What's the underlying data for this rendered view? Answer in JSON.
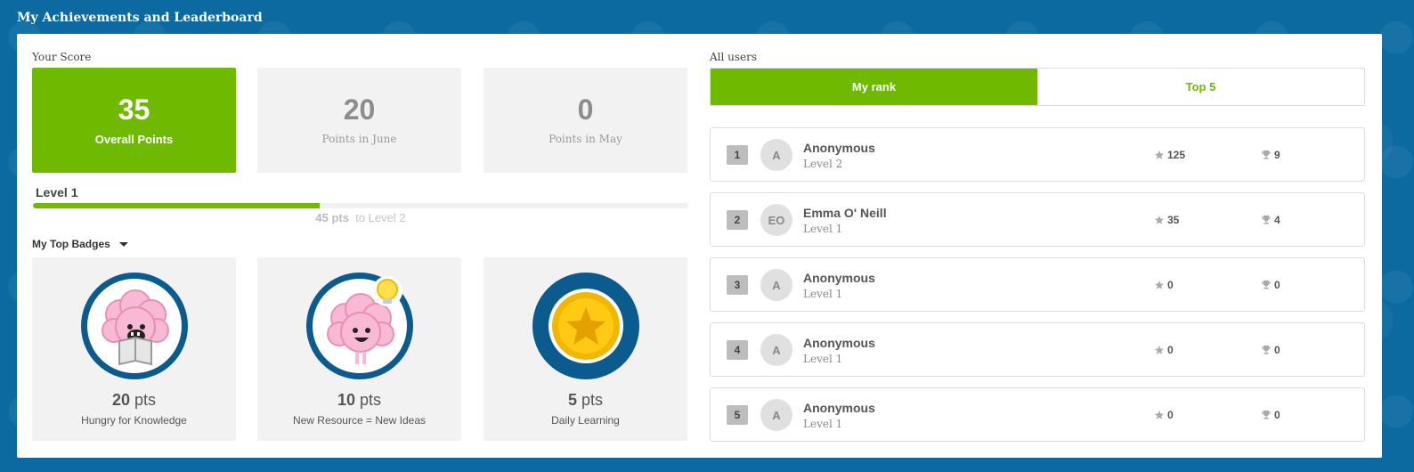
{
  "page": {
    "title": "My Achievements and Leaderboard"
  },
  "score": {
    "label": "Your Score",
    "boxes": [
      {
        "value": "35",
        "caption": "Overall Points"
      },
      {
        "value": "20",
        "caption": "Points in June"
      },
      {
        "value": "0",
        "caption": "Points in May"
      }
    ]
  },
  "level": {
    "title": "Level 1",
    "progress_fraction": 0.437,
    "pts_remaining": "45 pts",
    "to_label": "to Level 2"
  },
  "badges": {
    "dropdown_label": "My Top Badges",
    "items": [
      {
        "pts": "20",
        "unit": "pts",
        "name": "Hungry for Knowledge",
        "icon": "brain-reading-icon"
      },
      {
        "pts": "10",
        "unit": "pts",
        "name": "New Resource = New Ideas",
        "icon": "brain-lightbulb-icon"
      },
      {
        "pts": "5",
        "unit": "pts",
        "name": "Daily Learning",
        "icon": "gold-star-coin-icon"
      }
    ]
  },
  "leaderboard": {
    "label": "All users",
    "tabs": [
      {
        "label": "My rank",
        "active": true
      },
      {
        "label": "Top 5",
        "active": false
      }
    ],
    "rows": [
      {
        "rank": "1",
        "initials": "A",
        "name": "Anonymous",
        "level": "Level 2",
        "stars": "125",
        "trophies": "9"
      },
      {
        "rank": "2",
        "initials": "EO",
        "name": "Emma O' Neill",
        "level": "Level 1",
        "stars": "35",
        "trophies": "4"
      },
      {
        "rank": "3",
        "initials": "A",
        "name": "Anonymous",
        "level": "Level 1",
        "stars": "0",
        "trophies": "0"
      },
      {
        "rank": "4",
        "initials": "A",
        "name": "Anonymous",
        "level": "Level 1",
        "stars": "0",
        "trophies": "0"
      },
      {
        "rank": "5",
        "initials": "A",
        "name": "Anonymous",
        "level": "Level 1",
        "stars": "0",
        "trophies": "0"
      }
    ]
  },
  "colors": {
    "accent": "#6fba00",
    "background": "#0c6aa0",
    "badge_ring": "#0b5b8f"
  }
}
